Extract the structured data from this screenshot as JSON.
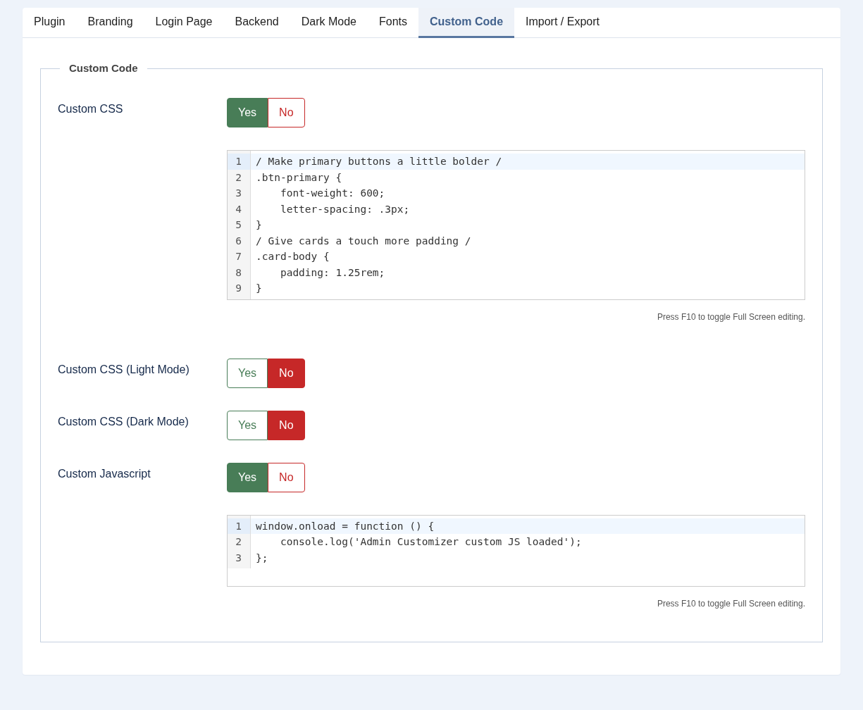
{
  "tabs": [
    {
      "label": "Plugin",
      "selected": false
    },
    {
      "label": "Branding",
      "selected": false
    },
    {
      "label": "Login Page",
      "selected": false
    },
    {
      "label": "Backend",
      "selected": false
    },
    {
      "label": "Dark Mode",
      "selected": false
    },
    {
      "label": "Fonts",
      "selected": false
    },
    {
      "label": "Custom Code",
      "selected": true
    },
    {
      "label": "Import / Export",
      "selected": false
    }
  ],
  "fieldset": {
    "legend": "Custom Code",
    "fields": [
      {
        "label": "Custom CSS",
        "options": [
          {
            "label": "Yes",
            "selected": true,
            "color": "#487d57"
          },
          {
            "label": "No",
            "selected": false,
            "color": "#c62828"
          }
        ],
        "editor": {
          "lines": [
            {
              "number": "1",
              "code": "/ Make primary buttons a little bolder /",
              "active": true
            },
            {
              "number": "2",
              "code": ".btn-primary {",
              "active": false
            },
            {
              "number": "3",
              "code": "    font-weight: 600;",
              "active": false
            },
            {
              "number": "4",
              "code": "    letter-spacing: .3px;",
              "active": false
            },
            {
              "number": "5",
              "code": "}",
              "active": false
            },
            {
              "number": "6",
              "code": "/ Give cards a touch more padding /",
              "active": false
            },
            {
              "number": "7",
              "code": ".card-body {",
              "active": false
            },
            {
              "number": "8",
              "code": "    padding: 1.25rem;",
              "active": false
            },
            {
              "number": "9",
              "code": "}",
              "active": false
            }
          ],
          "help": "Press F10 to toggle Full Screen editing."
        }
      },
      {
        "label": "Custom CSS (Light Mode)",
        "options": [
          {
            "label": "Yes",
            "selected": false,
            "color": "#487d57"
          },
          {
            "label": "No",
            "selected": true,
            "color": "#c62828"
          }
        ]
      },
      {
        "label": "Custom CSS (Dark Mode)",
        "options": [
          {
            "label": "Yes",
            "selected": false,
            "color": "#487d57"
          },
          {
            "label": "No",
            "selected": true,
            "color": "#c62828"
          }
        ]
      },
      {
        "label": "Custom Javascript",
        "options": [
          {
            "label": "Yes",
            "selected": true,
            "color": "#487d57"
          },
          {
            "label": "No",
            "selected": false,
            "color": "#c62828"
          }
        ],
        "editor": {
          "lines": [
            {
              "number": "1",
              "code": "window.onload = function () {",
              "active": true
            },
            {
              "number": "2",
              "code": "    console.log('Admin Customizer custom JS loaded');",
              "active": false
            },
            {
              "number": "3",
              "code": "};",
              "active": false
            }
          ],
          "help": "Press F10 to toggle Full Screen editing."
        }
      }
    ]
  }
}
